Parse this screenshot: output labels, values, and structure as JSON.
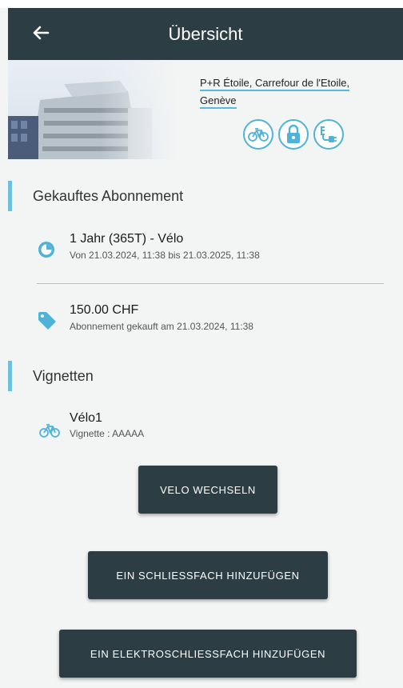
{
  "header": {
    "title": "Übersicht",
    "back_icon": "arrow-left-icon"
  },
  "location": {
    "line1": "P+R Étoile, Carrefour de l'Etoile,",
    "line2": "Genève",
    "amenity_icons": [
      "bicycle-icon",
      "lock-icon",
      "ev-plug-icon"
    ]
  },
  "subscription": {
    "section_title": "Gekauftes Abonnement",
    "plan_title": "1 Jahr (365T) - Vélo",
    "plan_period": "Von 21.03.2024, 11:38 bis 21.03.2025, 11:38",
    "price": "150.00 CHF",
    "purchased": "Abonnement gekauft am 21.03.2024, 11:38"
  },
  "vignettes": {
    "section_title": "Vignetten",
    "items": [
      {
        "name": "Vélo1",
        "detail": "Vignette : AAAAA"
      }
    ]
  },
  "buttons": {
    "change_bike": "VELO WECHSELN",
    "add_locker": "EIN SCHLIESSFACH HINZUFÜGEN",
    "add_e_locker": "EIN ELEKTROSCHLIESSFACH HINZUFÜGEN"
  },
  "colors": {
    "header_bg": "#2c3e44",
    "accent": "#4fb3d9",
    "button_bg": "#2c3e44"
  }
}
